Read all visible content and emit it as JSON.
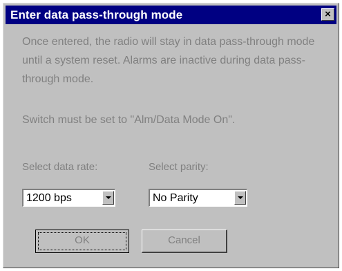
{
  "dialog": {
    "title": "Enter data pass-through mode",
    "close_glyph": "×",
    "message": "Once entered, the radio will stay in data pass-through mode until a system reset.  Alarms are inactive during data pass-through mode.",
    "switch_note": "Switch must be set to \"Alm/Data Mode On\".",
    "data_rate": {
      "label": "Select data rate:",
      "value": "1200 bps"
    },
    "parity": {
      "label": "Select parity:",
      "value": "No Parity"
    },
    "ok_label": "OK",
    "cancel_label": "Cancel"
  },
  "icons": {
    "close": "close-icon",
    "dropdown": "chevron-down-icon"
  },
  "colors": {
    "titlebar": "#000082",
    "face": "#c0c0c0",
    "disabled_text": "#808080"
  }
}
